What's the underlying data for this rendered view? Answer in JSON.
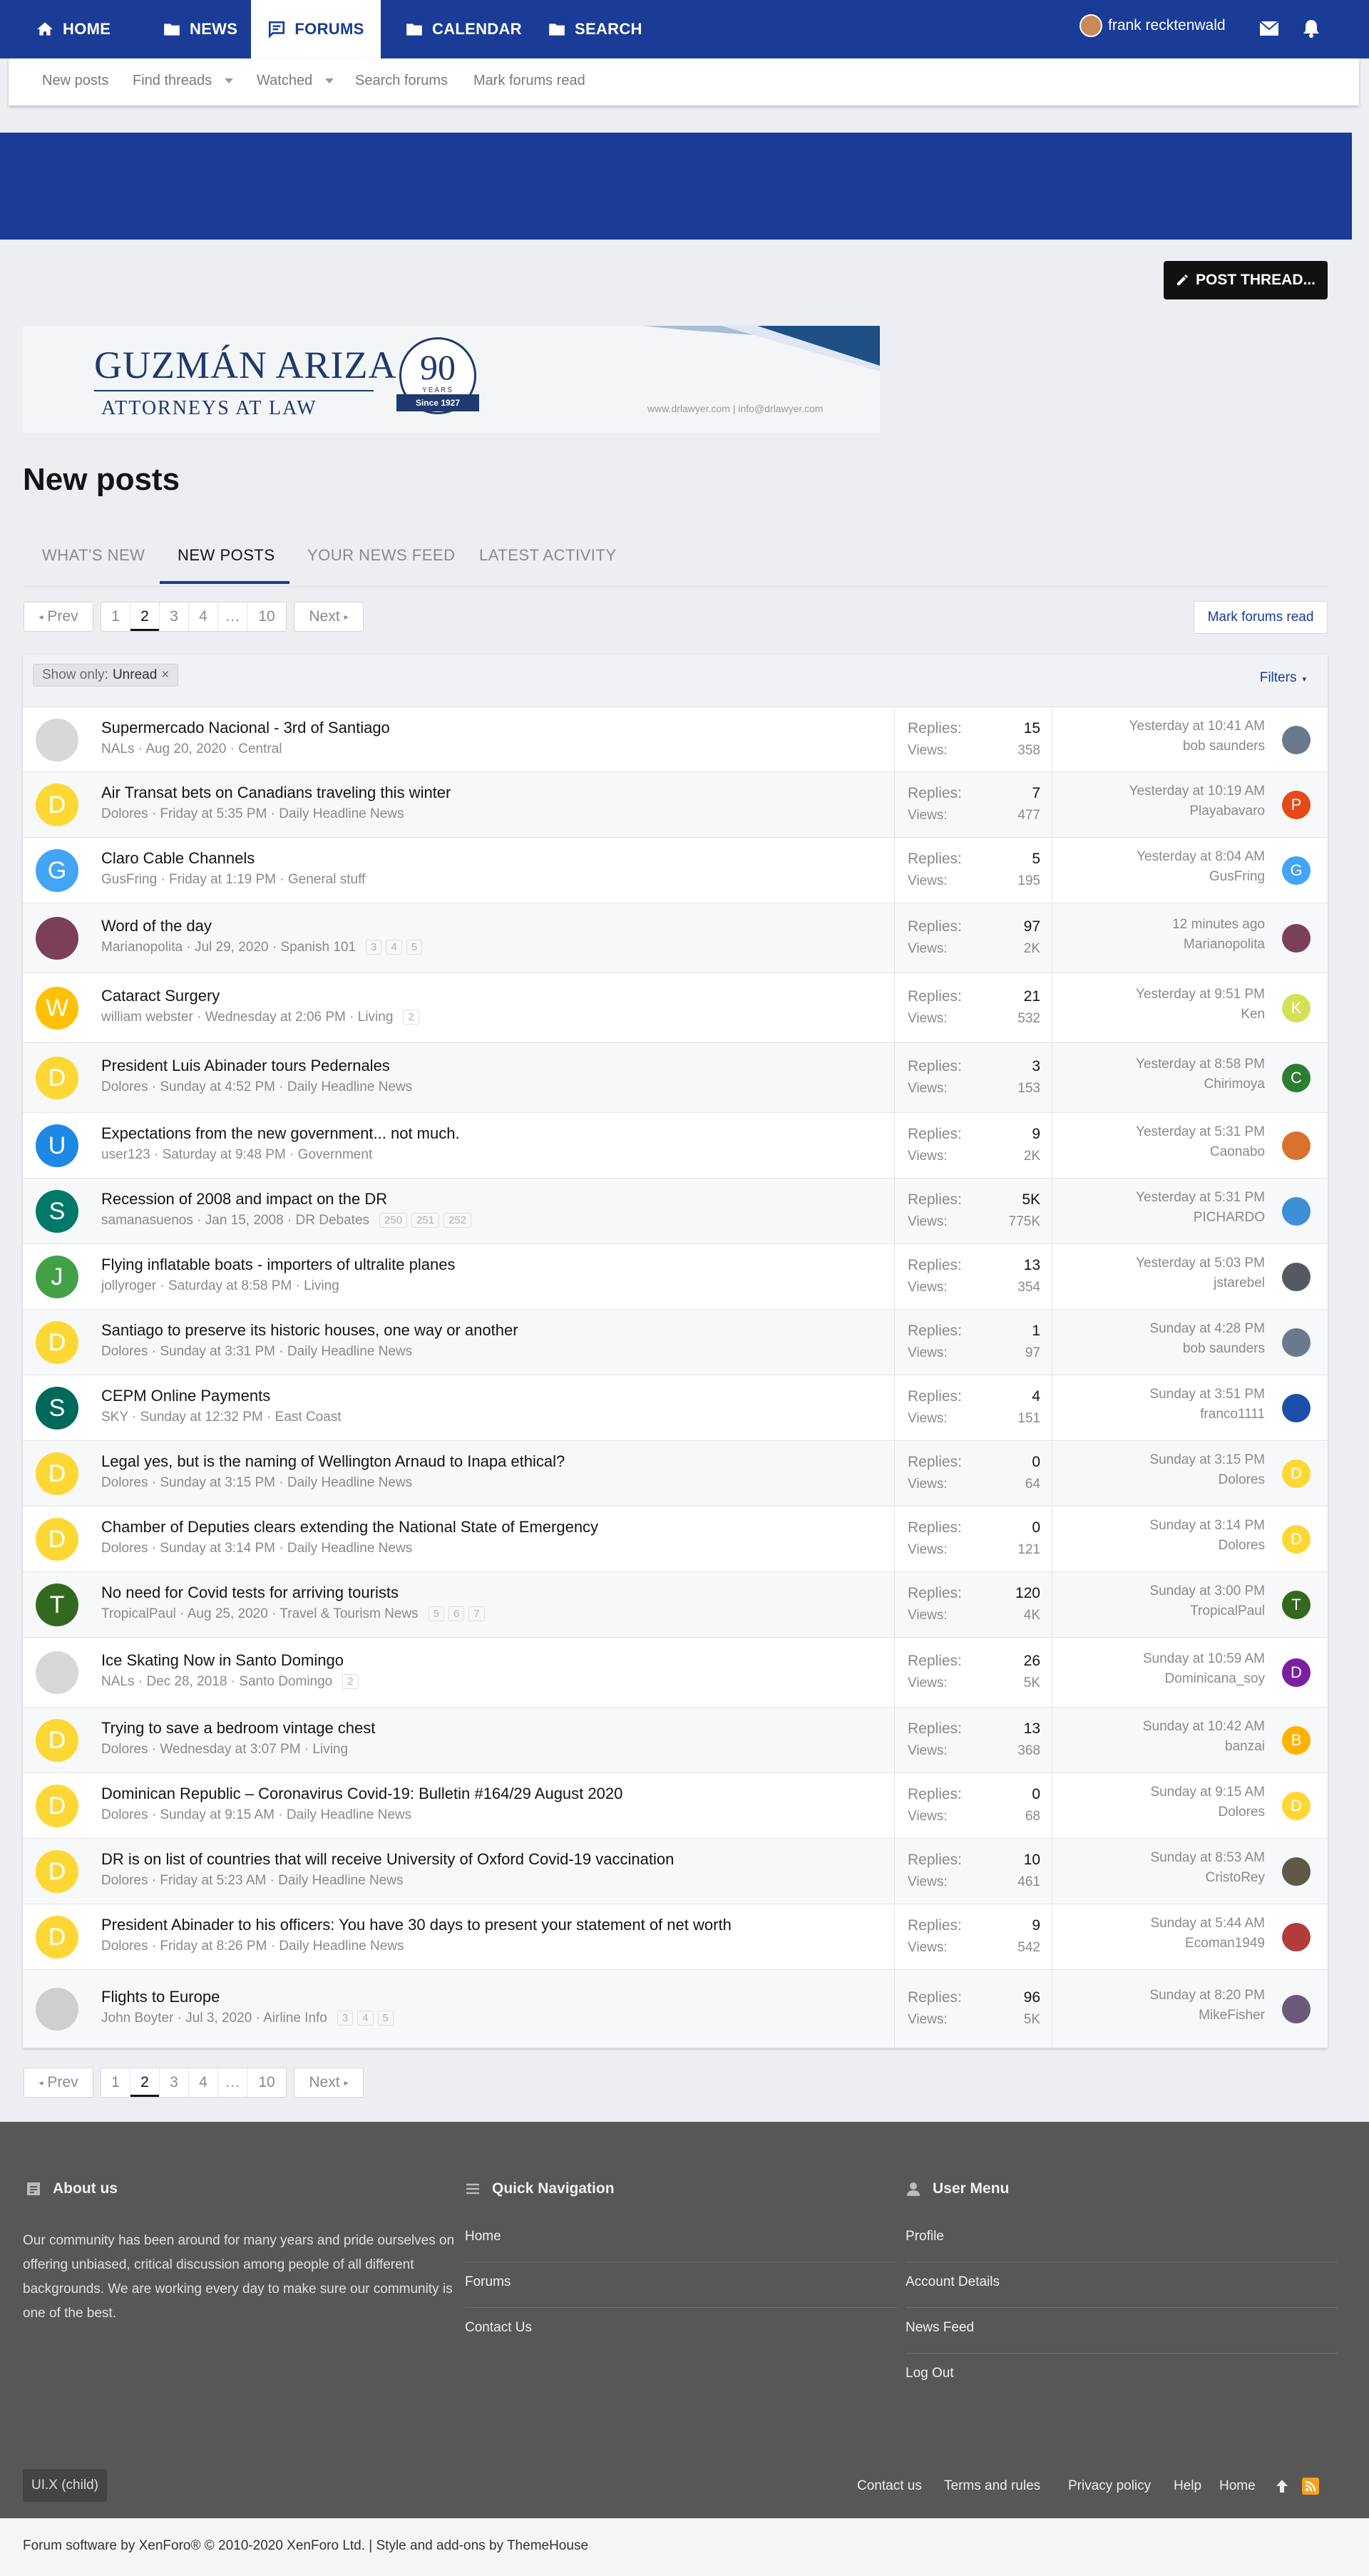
{
  "nav": {
    "tabs": [
      {
        "label": "HOME",
        "icon": "home-icon"
      },
      {
        "label": "NEWS",
        "icon": "folder-icon"
      },
      {
        "label": "FORUMS",
        "icon": "comment-icon"
      },
      {
        "label": "CALENDAR",
        "icon": "folder-icon"
      },
      {
        "label": "SEARCH",
        "icon": "folder-icon"
      }
    ],
    "active_tab": "FORUMS",
    "username": "frank recktenwald"
  },
  "subnav": {
    "items": [
      "New posts",
      "Find threads",
      "Watched",
      "Search forums",
      "Mark forums read"
    ]
  },
  "post_thread_label": "POST THREAD...",
  "banner": {
    "brand": "GUZMÁN ARIZA",
    "tagline": "ATTORNEYS AT LAW",
    "years": "90",
    "years_word": "YEARS",
    "since": "Since 1927",
    "contact": "www.drlawyer.com  |  info@drlawyer.com"
  },
  "page_title": "New posts",
  "tabs": [
    "WHAT'S NEW",
    "NEW POSTS",
    "YOUR NEWS FEED",
    "LATEST ACTIVITY"
  ],
  "pagination": {
    "prev": "Prev",
    "next": "Next",
    "pages": [
      "1",
      "2",
      "3",
      "4",
      "…",
      "10"
    ],
    "current": "2"
  },
  "mark_forums_read": "Mark forums read",
  "filter": {
    "show_only": "Show only:",
    "value": "Unread",
    "filters": "Filters"
  },
  "labels": {
    "replies": "Replies:",
    "views": "Views:"
  },
  "colors": {
    "brand_blue": "#1a3c97",
    "footer_bg": "#575757"
  },
  "threads": [
    {
      "title": "Supermercado Nacional - 3rd of Santiago",
      "author": "NALs",
      "date": "Aug 20, 2020",
      "forum": "Central",
      "pages": [],
      "replies": "15",
      "views": "358",
      "last_time": "Yesterday at 10:41 AM",
      "last_user": "bob saunders",
      "avatar": "",
      "avatar_color": "#d8d8d8",
      "mini": "",
      "mini_color": "#6a7a8c"
    },
    {
      "title": "Air Transat bets on Canadians traveling this winter",
      "author": "Dolores",
      "date": "Friday at 5:35 PM",
      "forum": "Daily Headline News",
      "pages": [],
      "replies": "7",
      "views": "477",
      "last_time": "Yesterday at 10:19 AM",
      "last_user": "Playabavaro",
      "avatar": "D",
      "avatar_color": "#fdd835",
      "mini": "P",
      "mini_color": "#e64a19"
    },
    {
      "title": "Claro Cable Channels",
      "author": "GusFring",
      "date": "Friday at 1:19 PM",
      "forum": "General stuff",
      "pages": [],
      "replies": "5",
      "views": "195",
      "last_time": "Yesterday at 8:04 AM",
      "last_user": "GusFring",
      "avatar": "G",
      "avatar_color": "#42a5f5",
      "mini": "G",
      "mini_color": "#42a5f5"
    },
    {
      "title": "Word of the day",
      "author": "Marianopolita",
      "date": "Jul 29, 2020",
      "forum": "Spanish 101",
      "pages": [
        "3",
        "4",
        "5"
      ],
      "replies": "97",
      "views": "2K",
      "last_time": "12 minutes ago",
      "last_user": "Marianopolita",
      "avatar": "",
      "avatar_color": "#7b3f5a",
      "mini": "",
      "mini_color": "#7b3f5a"
    },
    {
      "title": "Cataract Surgery",
      "author": "william webster",
      "date": "Wednesday at 2:06 PM",
      "forum": "Living",
      "pages": [
        "2"
      ],
      "replies": "21",
      "views": "532",
      "last_time": "Yesterday at 9:51 PM",
      "last_user": "Ken",
      "avatar": "W",
      "avatar_color": "#ffc107",
      "mini": "K",
      "mini_color": "#d4e157"
    },
    {
      "title": "President Luis Abinader tours Pedernales",
      "author": "Dolores",
      "date": "Sunday at 4:52 PM",
      "forum": "Daily Headline News",
      "pages": [],
      "replies": "3",
      "views": "153",
      "last_time": "Yesterday at 8:58 PM",
      "last_user": "Chirimoya",
      "avatar": "D",
      "avatar_color": "#fdd835",
      "mini": "C",
      "mini_color": "#2e7d32"
    },
    {
      "title": "Expectations from the new government... not much.",
      "author": "user123",
      "date": "Saturday at 9:48 PM",
      "forum": "Government",
      "pages": [],
      "replies": "9",
      "views": "2K",
      "last_time": "Yesterday at 5:31 PM",
      "last_user": "Caonabo",
      "avatar": "U",
      "avatar_color": "#1e88e5",
      "mini": "",
      "mini_color": "#d9712f"
    },
    {
      "title": "Recession of 2008 and impact on the DR",
      "author": "samanasuenos",
      "date": "Jan 15, 2008",
      "forum": "DR Debates",
      "pages": [
        "250",
        "251",
        "252"
      ],
      "replies": "5K",
      "views": "775K",
      "last_time": "Yesterday at 5:31 PM",
      "last_user": "PICHARDO",
      "avatar": "S",
      "avatar_color": "#00796b",
      "mini": "",
      "mini_color": "#3d8fd6"
    },
    {
      "title": "Flying inflatable boats - importers of ultralite planes",
      "author": "jollyroger",
      "date": "Saturday at 8:58 PM",
      "forum": "Living",
      "pages": [],
      "replies": "13",
      "views": "354",
      "last_time": "Yesterday at 5:03 PM",
      "last_user": "jstarebel",
      "avatar": "J",
      "avatar_color": "#43a047",
      "mini": "",
      "mini_color": "#555a60"
    },
    {
      "title": "Santiago to preserve its historic houses, one way or another",
      "author": "Dolores",
      "date": "Sunday at 3:31 PM",
      "forum": "Daily Headline News",
      "pages": [],
      "replies": "1",
      "views": "97",
      "last_time": "Sunday at 4:28 PM",
      "last_user": "bob saunders",
      "avatar": "D",
      "avatar_color": "#fdd835",
      "mini": "",
      "mini_color": "#6a7a8c"
    },
    {
      "title": "CEPM Online Payments",
      "author": "SKY",
      "date": "Sunday at 12:32 PM",
      "forum": "East Coast",
      "pages": [],
      "replies": "4",
      "views": "151",
      "last_time": "Sunday at 3:51 PM",
      "last_user": "franco1111",
      "avatar": "S",
      "avatar_color": "#00695c",
      "mini": "",
      "mini_color": "#1c4fa8"
    },
    {
      "title": "Legal yes, but is the naming of Wellington Arnaud to Inapa ethical?",
      "author": "Dolores",
      "date": "Sunday at 3:15 PM",
      "forum": "Daily Headline News",
      "pages": [],
      "replies": "0",
      "views": "64",
      "last_time": "Sunday at 3:15 PM",
      "last_user": "Dolores",
      "avatar": "D",
      "avatar_color": "#fdd835",
      "mini": "D",
      "mini_color": "#fdd835"
    },
    {
      "title": "Chamber of Deputies clears extending the National State of Emergency",
      "author": "Dolores",
      "date": "Sunday at 3:14 PM",
      "forum": "Daily Headline News",
      "pages": [],
      "replies": "0",
      "views": "121",
      "last_time": "Sunday at 3:14 PM",
      "last_user": "Dolores",
      "avatar": "D",
      "avatar_color": "#fdd835",
      "mini": "D",
      "mini_color": "#fdd835"
    },
    {
      "title": "No need for Covid tests for arriving tourists",
      "author": "TropicalPaul",
      "date": "Aug 25, 2020",
      "forum": "Travel & Tourism News",
      "pages": [
        "5",
        "6",
        "7"
      ],
      "replies": "120",
      "views": "4K",
      "last_time": "Sunday at 3:00 PM",
      "last_user": "TropicalPaul",
      "avatar": "T",
      "avatar_color": "#33691e",
      "mini": "T",
      "mini_color": "#33691e"
    },
    {
      "title": "Ice Skating Now in Santo Domingo",
      "author": "NALs",
      "date": "Dec 28, 2018",
      "forum": "Santo Domingo",
      "pages": [
        "2"
      ],
      "replies": "26",
      "views": "5K",
      "last_time": "Sunday at 10:59 AM",
      "last_user": "Dominicana_soy",
      "avatar": "",
      "avatar_color": "#d8d8d8",
      "mini": "D",
      "mini_color": "#7b1fa2"
    },
    {
      "title": "Trying to save a bedroom vintage chest",
      "author": "Dolores",
      "date": "Wednesday at 3:07 PM",
      "forum": "Living",
      "pages": [],
      "replies": "13",
      "views": "368",
      "last_time": "Sunday at 10:42 AM",
      "last_user": "banzai",
      "avatar": "D",
      "avatar_color": "#fdd835",
      "mini": "B",
      "mini_color": "#ffb300"
    },
    {
      "title": "Dominican Republic – Coronavirus Covid-19: Bulletin #164/29 August 2020",
      "author": "Dolores",
      "date": "Sunday at 9:15 AM",
      "forum": "Daily Headline News",
      "pages": [],
      "replies": "0",
      "views": "68",
      "last_time": "Sunday at 9:15 AM",
      "last_user": "Dolores",
      "avatar": "D",
      "avatar_color": "#fdd835",
      "mini": "D",
      "mini_color": "#fdd835"
    },
    {
      "title": "DR is on list of countries that will receive University of Oxford Covid-19 vaccination",
      "author": "Dolores",
      "date": "Friday at 5:23 AM",
      "forum": "Daily Headline News",
      "pages": [],
      "replies": "10",
      "views": "461",
      "last_time": "Sunday at 8:53 AM",
      "last_user": "CristoRey",
      "avatar": "D",
      "avatar_color": "#fdd835",
      "mini": "",
      "mini_color": "#5d5a48"
    },
    {
      "title": "President Abinader to his officers: You have 30 days to present your statement of net worth",
      "author": "Dolores",
      "date": "Friday at 8:26 PM",
      "forum": "Daily Headline News",
      "pages": [],
      "replies": "9",
      "views": "542",
      "last_time": "Sunday at 5:44 AM",
      "last_user": "Ecoman1949",
      "avatar": "D",
      "avatar_color": "#fdd835",
      "mini": "",
      "mini_color": "#b23c3c"
    },
    {
      "title": "Flights to Europe",
      "author": "John Boyter",
      "date": "Jul 3, 2020",
      "forum": "Airline Info",
      "pages": [
        "3",
        "4",
        "5"
      ],
      "replies": "96",
      "views": "5K",
      "last_time": "Sunday at 8:20 PM",
      "last_user": "MikeFisher",
      "avatar": "",
      "avatar_color": "#cfcfcf",
      "mini": "",
      "mini_color": "#6a5a7a"
    }
  ],
  "footer": {
    "about_title": "About us",
    "about_text": "Our community has been around for many years and pride ourselves on offering unbiased, critical discussion among people of all different backgrounds. We are working every day to make sure our community is one of the best.",
    "quick_nav_title": "Quick Navigation",
    "quick_nav": [
      "Home",
      "Forums",
      "Contact Us"
    ],
    "user_menu_title": "User Menu",
    "user_menu": [
      "Profile",
      "Account Details",
      "News Feed",
      "Log Out"
    ],
    "style_chooser": "UI.X (child)",
    "bottom_links": [
      "Contact us",
      "Terms and rules",
      "Privacy policy",
      "Help",
      "Home"
    ],
    "copyright": "Forum software by XenForo® © 2010-2020 XenForo Ltd. | Style and add-ons by ThemeHouse"
  }
}
